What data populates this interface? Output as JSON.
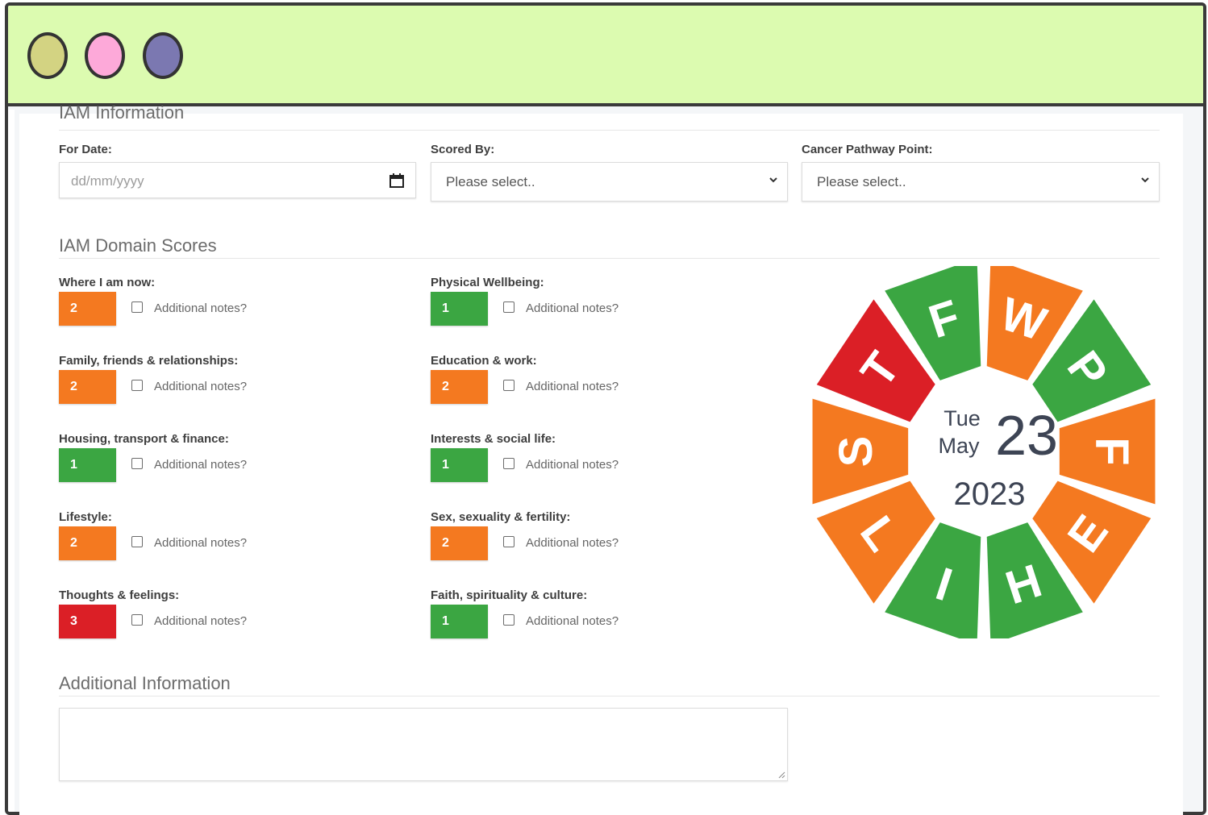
{
  "colors": {
    "orange": "#f47920",
    "green": "#3ba642",
    "red": "#db1f26",
    "titlebar": "#dcfbb0"
  },
  "sections": {
    "iam_info": "IAM Information",
    "domain_scores": "IAM Domain Scores",
    "additional_info": "Additional Information"
  },
  "form": {
    "for_date": {
      "label": "For Date:",
      "placeholder": "dd/mm/yyyy"
    },
    "scored_by": {
      "label": "Scored By:",
      "value": "Please select.."
    },
    "cancer_pathway": {
      "label": "Cancer Pathway Point:",
      "value": "Please select.."
    }
  },
  "notes_label": "Additional notes?",
  "domains": [
    {
      "label": "Where I am now:",
      "score": "2",
      "color": "#f47920"
    },
    {
      "label": "Physical Wellbeing:",
      "score": "1",
      "color": "#3ba642"
    },
    {
      "label": "Family, friends & relationships:",
      "score": "2",
      "color": "#f47920"
    },
    {
      "label": "Education & work:",
      "score": "2",
      "color": "#f47920"
    },
    {
      "label": "Housing, transport & finance:",
      "score": "1",
      "color": "#3ba642"
    },
    {
      "label": "Interests & social life:",
      "score": "1",
      "color": "#3ba642"
    },
    {
      "label": "Lifestyle:",
      "score": "2",
      "color": "#f47920"
    },
    {
      "label": "Sex, sexuality & fertility:",
      "score": "2",
      "color": "#f47920"
    },
    {
      "label": "Thoughts & feelings:",
      "score": "3",
      "color": "#db1f26"
    },
    {
      "label": "Faith, spirituality & culture:",
      "score": "1",
      "color": "#3ba642"
    }
  ],
  "wheel": {
    "weekday": "Tue",
    "month": "May",
    "day": "23",
    "year": "2023",
    "segments": [
      {
        "letter": "W",
        "color": "#f47920"
      },
      {
        "letter": "P",
        "color": "#3ba642"
      },
      {
        "letter": "F",
        "color": "#f47920"
      },
      {
        "letter": "E",
        "color": "#f47920"
      },
      {
        "letter": "H",
        "color": "#3ba642"
      },
      {
        "letter": "I",
        "color": "#3ba642"
      },
      {
        "letter": "L",
        "color": "#f47920"
      },
      {
        "letter": "S",
        "color": "#f47920"
      },
      {
        "letter": "T",
        "color": "#db1f26"
      },
      {
        "letter": "F",
        "color": "#3ba642"
      }
    ]
  }
}
